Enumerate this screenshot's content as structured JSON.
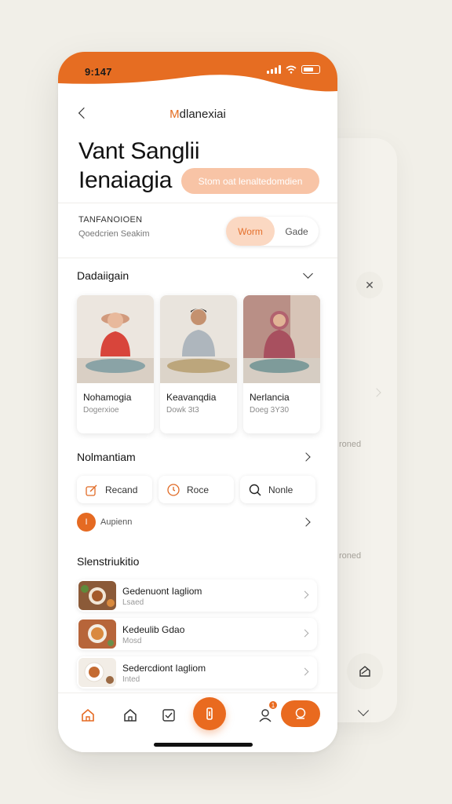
{
  "status": {
    "time": "9:147"
  },
  "nav": {
    "title_first": "M",
    "title_rest": "dlanexiai"
  },
  "hero": {
    "line1": "Vant Sanglii",
    "line2": "Ienaiagia",
    "pill": "Stom oat lenaltedomdien"
  },
  "filter": {
    "label": "TANFANOIOEN",
    "sub": "Qoedcrien Seakim",
    "options": [
      "Worm",
      "Gade"
    ],
    "selected": "Worm"
  },
  "section1": {
    "title": "Dadaiigain",
    "cards": [
      {
        "name": "Nohamogia",
        "sub": "Dogerxioe"
      },
      {
        "name": "Keavanqdia",
        "sub": "Dowk 3t3"
      },
      {
        "name": "Nerlancia",
        "sub": "Doeg 3Y30"
      }
    ]
  },
  "section2": {
    "title": "Nolmantiam",
    "chips": [
      {
        "label": "Recand",
        "icon": "edit-icon"
      },
      {
        "label": "Roce",
        "icon": "clock-icon"
      },
      {
        "label": "Nonle",
        "icon": "search-icon"
      }
    ],
    "add": {
      "badge": "I",
      "label": "Aupienn"
    }
  },
  "section3": {
    "title": "Slenstriukitio",
    "items": [
      {
        "title": "Gedenuont Iagliom",
        "sub": "Lsaed"
      },
      {
        "title": "Kedeulib Gdao",
        "sub": "Mosd"
      },
      {
        "title": "Sedercdiont Iagliom",
        "sub": "Inted"
      }
    ]
  },
  "ghost": {
    "text1": "roned",
    "text2": "roned"
  },
  "tabbar": {
    "badge": "1"
  },
  "colors": {
    "accent": "#e96a1f",
    "accent_soft": "#f8c4a6",
    "background": "#f1efe8"
  }
}
